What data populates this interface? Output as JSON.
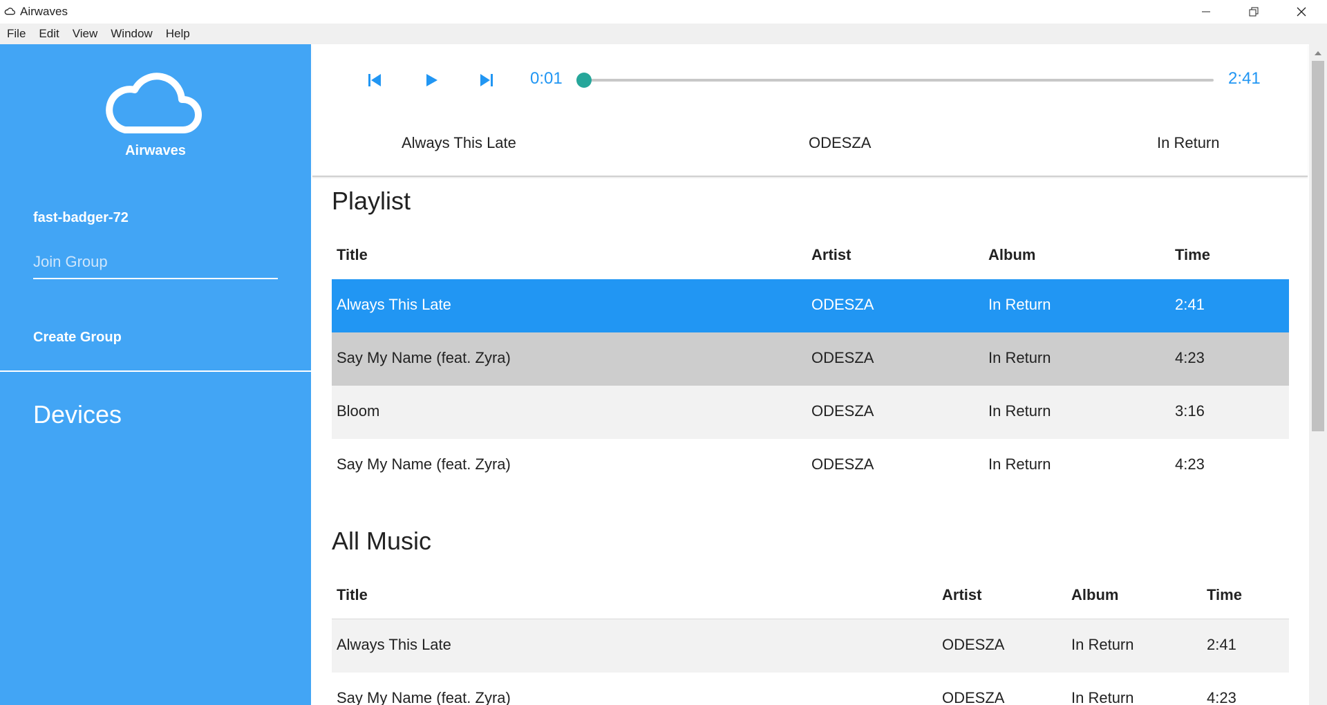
{
  "window": {
    "title": "Airwaves"
  },
  "menu": {
    "items": [
      "File",
      "Edit",
      "View",
      "Window",
      "Help"
    ]
  },
  "sidebar": {
    "brand": "Airwaves",
    "username": "fast-badger-72",
    "join_placeholder": "Join Group",
    "create_group": "Create Group",
    "devices_heading": "Devices"
  },
  "player": {
    "current_time": "0:01",
    "total_time": "2:41",
    "progress_percent": 1,
    "now_playing": {
      "title": "Always This Late",
      "artist": "ODESZA",
      "album": "In Return"
    }
  },
  "playlist": {
    "heading": "Playlist",
    "columns": [
      "Title",
      "Artist",
      "Album",
      "Time"
    ],
    "rows": [
      {
        "title": "Always This Late",
        "artist": "ODESZA",
        "album": "In Return",
        "time": "2:41",
        "state": "selected"
      },
      {
        "title": "Say My Name (feat. Zyra)",
        "artist": "ODESZA",
        "album": "In Return",
        "time": "4:23",
        "state": "hover"
      },
      {
        "title": "Bloom",
        "artist": "ODESZA",
        "album": "In Return",
        "time": "3:16",
        "state": "alt"
      },
      {
        "title": "Say My Name (feat. Zyra)",
        "artist": "ODESZA",
        "album": "In Return",
        "time": "4:23",
        "state": "normal"
      }
    ]
  },
  "all_music": {
    "heading": "All Music",
    "columns": [
      "Title",
      "Artist",
      "Album",
      "Time"
    ],
    "rows": [
      {
        "title": "Always This Late",
        "artist": "ODESZA",
        "album": "In Return",
        "time": "2:41",
        "state": "alt"
      },
      {
        "title": "Say My Name (feat. Zyra)",
        "artist": "ODESZA",
        "album": "In Return",
        "time": "4:23",
        "state": "normal"
      }
    ]
  },
  "colors": {
    "sidebar": "#42a5f5",
    "accent": "#2196f3",
    "seek_thumb": "#26a69a",
    "row_hover": "#cdcdcd",
    "row_alt": "#f2f2f2"
  }
}
